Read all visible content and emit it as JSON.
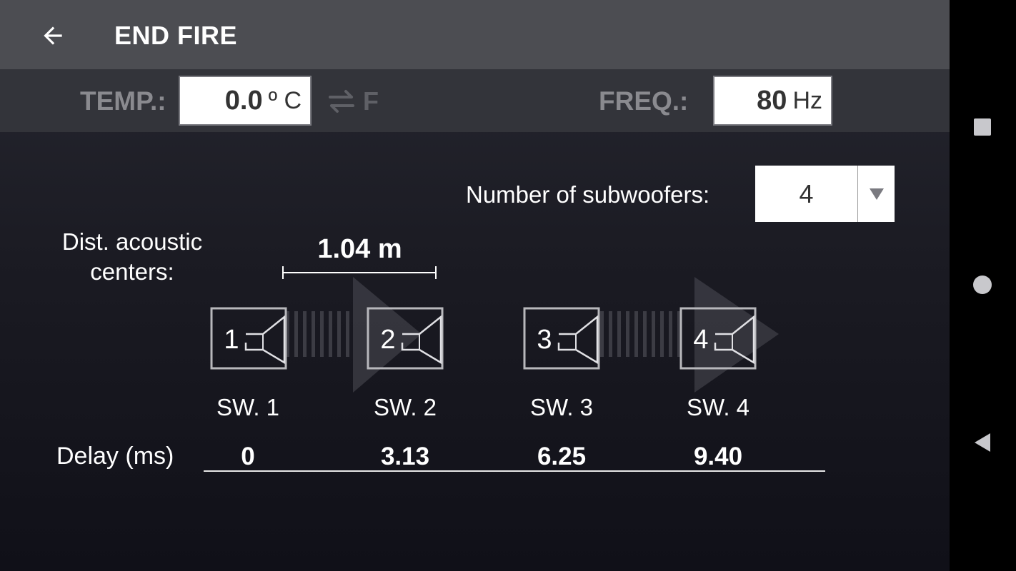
{
  "header": {
    "title": "END FIRE",
    "back_icon": "arrow-back-icon"
  },
  "settings": {
    "temp": {
      "label": "TEMP.:",
      "value": "0.0",
      "unit": "º C",
      "alt_unit": "F"
    },
    "freq": {
      "label": "FREQ.:",
      "value": "80",
      "unit": "Hz"
    }
  },
  "subwoofer_count": {
    "label": "Number of subwoofers:",
    "value": "4"
  },
  "distance": {
    "label_line1": "Dist. acoustic",
    "label_line2": "centers:",
    "value": "1.04 m"
  },
  "subwoofers": [
    {
      "number": "1",
      "label": "SW. 1",
      "delay": "0"
    },
    {
      "number": "2",
      "label": "SW. 2",
      "delay": "3.13"
    },
    {
      "number": "3",
      "label": "SW. 3",
      "delay": "6.25"
    },
    {
      "number": "4",
      "label": "SW. 4",
      "delay": "9.40"
    }
  ],
  "delay_label": "Delay (ms)",
  "colors": {
    "appbar": "#4c4d52",
    "settings_bar": "#33343a",
    "background": "#1b1b23",
    "text": "#ffffff",
    "muted": "#8a8a8f"
  },
  "navbar": {
    "buttons": [
      "recents-square-icon",
      "home-circle-icon",
      "back-triangle-icon"
    ]
  }
}
